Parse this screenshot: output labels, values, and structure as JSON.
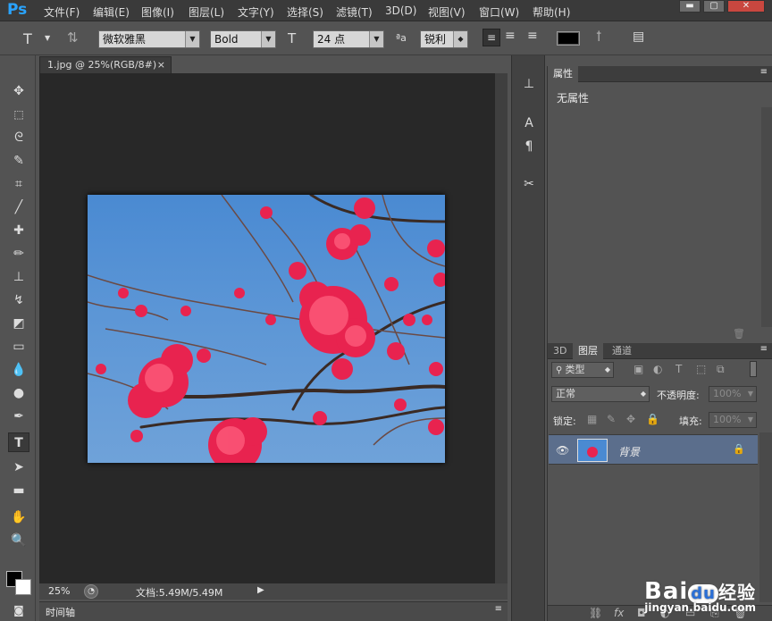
{
  "app": {
    "logo": "Ps"
  },
  "menu": [
    "文件(F)",
    "编辑(E)",
    "图像(I)",
    "图层(L)",
    "文字(Y)",
    "选择(S)",
    "滤镜(T)",
    "3D(D)",
    "视图(V)",
    "窗口(W)",
    "帮助(H)"
  ],
  "window_controls": {
    "minimize": "▬",
    "maximize": "▢",
    "close": "✕"
  },
  "options": {
    "tool_icon": "T",
    "font_family": "微软雅黑",
    "font_style": "Bold",
    "font_size": "24 点",
    "aa_icon": "ªa",
    "antialias": "锐利",
    "text_color": "#000000"
  },
  "document": {
    "tab_title": "1.jpg @ 25%(RGB/8#)",
    "tab_close": "×"
  },
  "status": {
    "zoom": "25%",
    "doc_info": "文档:5.49M/5.49M"
  },
  "timeline": {
    "label": "时间轴"
  },
  "properties": {
    "tab": "属性",
    "content": "无属性"
  },
  "layers_panel": {
    "tabs": [
      "3D",
      "图层",
      "通道"
    ],
    "filter_label": "类型",
    "blend_mode": "正常",
    "opacity_label": "不透明度:",
    "opacity_value": "100%",
    "lock_label": "锁定:",
    "fill_label": "填充:",
    "fill_value": "100%",
    "layer_name": "背景"
  },
  "watermark": {
    "text": "Bai",
    "paw": "du",
    "suffix": "经验",
    "url": "jingyan.baidu.com"
  }
}
